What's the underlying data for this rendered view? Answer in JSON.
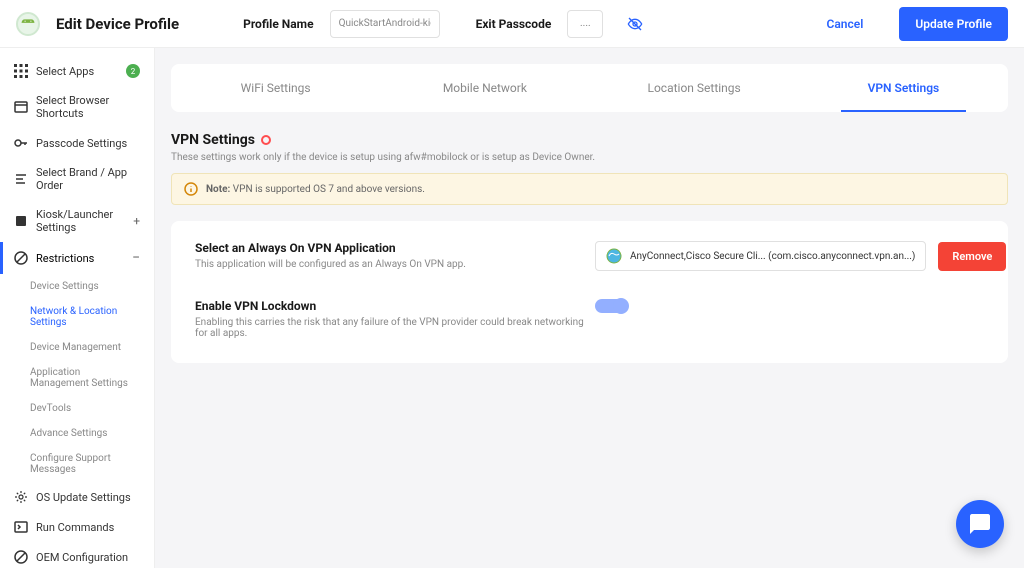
{
  "header": {
    "page_title": "Edit Device Profile",
    "profile_name_label": "Profile Name",
    "profile_name_value": "QuickStartAndroid-kiosk",
    "exit_passcode_label": "Exit Passcode",
    "exit_passcode_value": "....",
    "cancel": "Cancel",
    "update": "Update Profile"
  },
  "sidebar": {
    "items": [
      {
        "label": "Select Apps",
        "badge": "2"
      },
      {
        "label": "Select Browser Shortcuts"
      },
      {
        "label": "Passcode Settings"
      },
      {
        "label": "Select Brand / App Order"
      },
      {
        "label": "Kiosk/Launcher Settings"
      },
      {
        "label": "Restrictions"
      },
      {
        "label": "OS Update Settings"
      },
      {
        "label": "Run Commands"
      },
      {
        "label": "OEM Configuration"
      }
    ],
    "sub_items": [
      {
        "label": "Device Settings"
      },
      {
        "label": "Network & Location Settings"
      },
      {
        "label": "Device Management"
      },
      {
        "label": "Application Management Settings"
      },
      {
        "label": "DevTools"
      },
      {
        "label": "Advance Settings"
      },
      {
        "label": "Configure Support Messages"
      }
    ]
  },
  "tabs": {
    "items": [
      {
        "label": "WiFi Settings"
      },
      {
        "label": "Mobile Network"
      },
      {
        "label": "Location Settings"
      },
      {
        "label": "VPN Settings"
      }
    ]
  },
  "vpn": {
    "title": "VPN Settings",
    "subtitle": "These settings work only if the device is setup using afw#mobilock or is setup as Device Owner.",
    "note_label": "Note:",
    "note_text": "VPN is supported OS 7 and above versions.",
    "always_on": {
      "title": "Select an Always On VPN Application",
      "desc": "This application will be configured as an Always On VPN app.",
      "app_name": "AnyConnect,Cisco Secure Cli...  (com.cisco.anyconnect.vpn.an...)",
      "remove": "Remove"
    },
    "lockdown": {
      "title": "Enable VPN Lockdown",
      "desc": "Enabling this carries the risk that any failure of the VPN provider could break networking for all apps."
    }
  }
}
